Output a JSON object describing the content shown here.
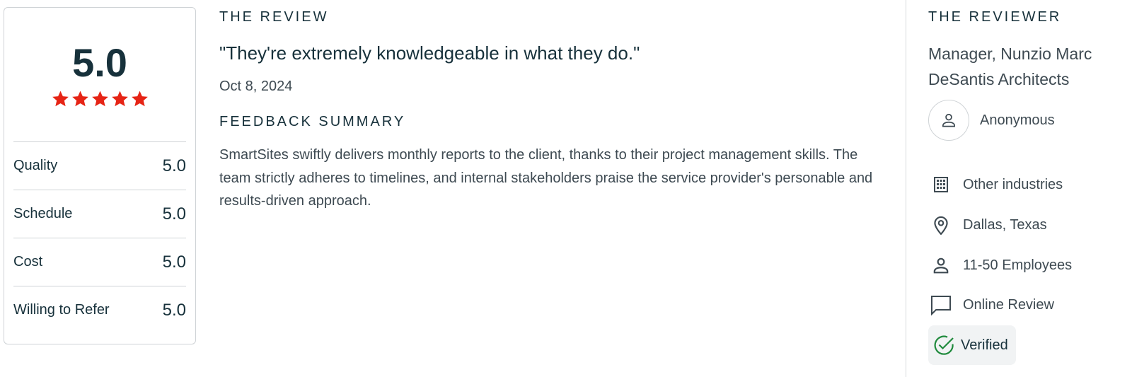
{
  "score_card": {
    "overall": "5.0",
    "star_rating": 5,
    "star_color": "#e62415",
    "rows": [
      {
        "label": "Quality",
        "value": "5.0"
      },
      {
        "label": "Schedule",
        "value": "5.0"
      },
      {
        "label": "Cost",
        "value": "5.0"
      },
      {
        "label": "Willing to Refer",
        "value": "5.0"
      }
    ]
  },
  "review": {
    "heading": "THE REVIEW",
    "quote": "\"They're extremely knowledgeable in what they do.\"",
    "date": "Oct 8, 2024",
    "feedback_heading": "FEEDBACK SUMMARY",
    "feedback_text": "SmartSites swiftly delivers monthly reports to the client, thanks to their project management skills. The team strictly adheres to timelines, and internal stakeholders praise the service provider's personable and results-driven approach."
  },
  "reviewer": {
    "heading": "THE REVIEWER",
    "title": "Manager, Nunzio Marc DeSantis Architects",
    "name": "Anonymous",
    "details": [
      {
        "icon": "building-icon",
        "text": "Other industries"
      },
      {
        "icon": "location-pin-icon",
        "text": "Dallas, Texas"
      },
      {
        "icon": "person-icon",
        "text": "11-50 Employees"
      },
      {
        "icon": "chat-bubble-icon",
        "text": "Online Review"
      }
    ],
    "verified_label": "Verified",
    "verified_color": "#1f8a3c"
  }
}
